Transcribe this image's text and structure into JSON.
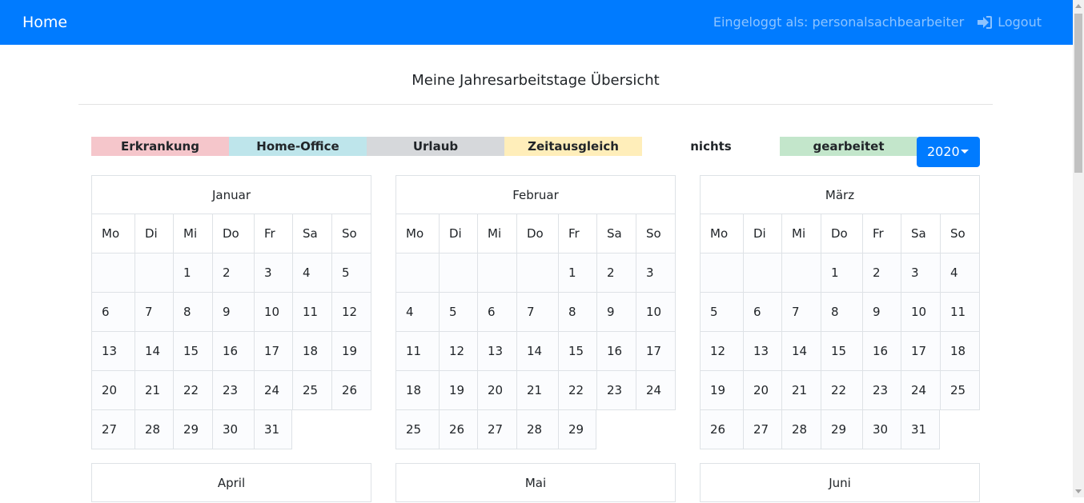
{
  "navbar": {
    "brand": "Home",
    "logged_in_text": "Eingeloggt als: personalsachbearbeiter",
    "logout_label": "Logout",
    "logout_icon": "sign-in-icon"
  },
  "page": {
    "title": "Meine Jahresarbeitstage Übersicht"
  },
  "legend": [
    {
      "label": "Erkrankung",
      "color": "#f5c6cb"
    },
    {
      "label": "Home-Office",
      "color": "#bee5eb"
    },
    {
      "label": "Urlaub",
      "color": "#d6d8db"
    },
    {
      "label": "Zeitausgleich",
      "color": "#ffeeba"
    },
    {
      "label": "nichts",
      "color": "#ffffff"
    },
    {
      "label": "gearbeitet",
      "color": "#c3e6cb"
    }
  ],
  "year_select": {
    "value": "2020"
  },
  "weekdays": [
    "Mo",
    "Di",
    "Mi",
    "Do",
    "Fr",
    "Sa",
    "So"
  ],
  "months": [
    {
      "name": "Januar",
      "offset": 2,
      "days": 31
    },
    {
      "name": "Februar",
      "offset": 4,
      "days": 29
    },
    {
      "name": "März",
      "offset": 3,
      "days": 31
    },
    {
      "name": "April"
    },
    {
      "name": "Mai"
    },
    {
      "name": "Juni"
    }
  ],
  "colors": {
    "primary": "#007bff",
    "border": "#dee2e6"
  }
}
